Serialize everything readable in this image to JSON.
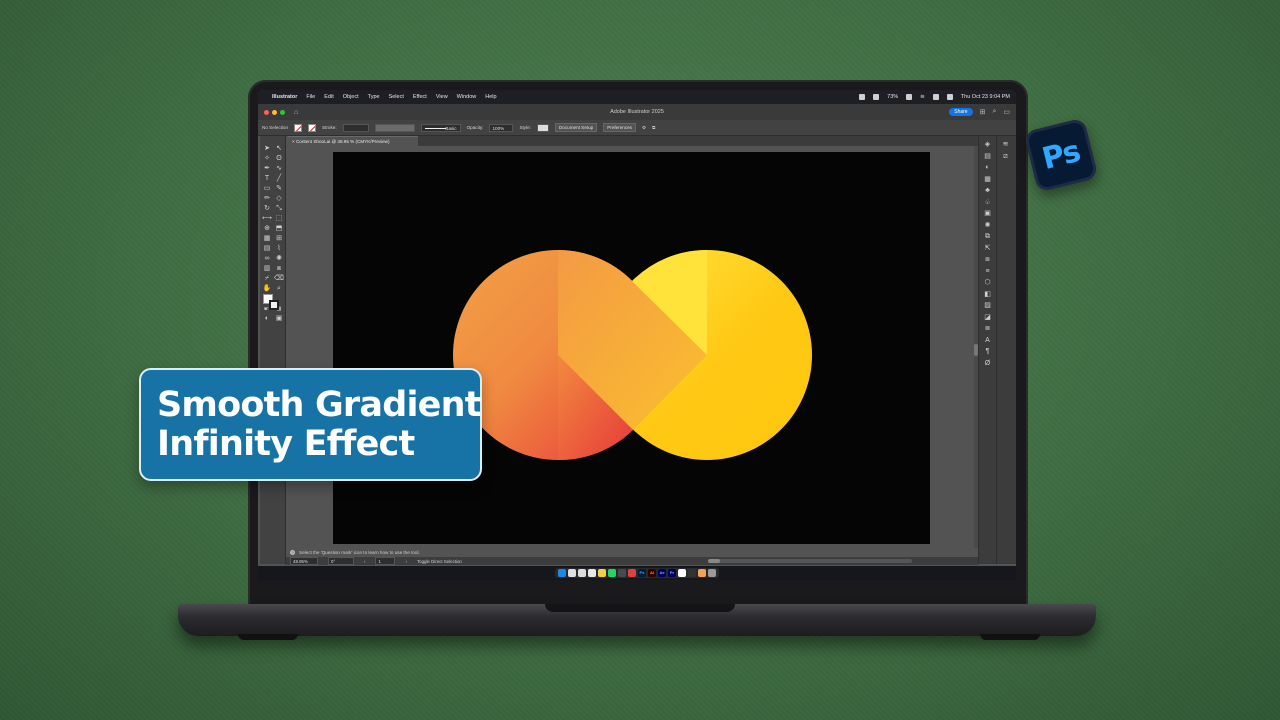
{
  "menubar": {
    "app_name": "Illustrator",
    "items": [
      "File",
      "Edit",
      "Object",
      "Type",
      "Select",
      "Effect",
      "View",
      "Window",
      "Help"
    ],
    "battery": "73%",
    "datetime": "Thu Oct 23  9:04 PM"
  },
  "titlebar": {
    "title": "Adobe Illustrator 2025",
    "share_label": "Share"
  },
  "controlbar": {
    "selection": "No Selection",
    "stroke_label": "Stroke:",
    "brush_value": "Basic",
    "opacity_label": "Opacity:",
    "opacity_value": "100%",
    "style_label": "Style:",
    "document_setup": "Document Setup",
    "preferences": "Preferences"
  },
  "document": {
    "tab_title": "Content ShooLai @ 48.95 % (CMYK/Preview)"
  },
  "statusbar": {
    "hint": "Select the 'Question mark' icon to learn how to use the tool.",
    "zoom": "48.95%",
    "rotation": "0°",
    "artboard_index": "1",
    "current_tool": "Toggle Direct Selection"
  },
  "badge": {
    "text": "Ps"
  },
  "headline": {
    "line1": "Smooth Gradient",
    "line2": "Infinity Effect"
  },
  "colors": {
    "background_green": "#3f6d42",
    "headline_blue": "#1773a6",
    "gradient_orange": "#f08a40",
    "gradient_red": "#e8343a",
    "gradient_yellow": "#ffc814",
    "ps_blue": "#31a8ff"
  }
}
